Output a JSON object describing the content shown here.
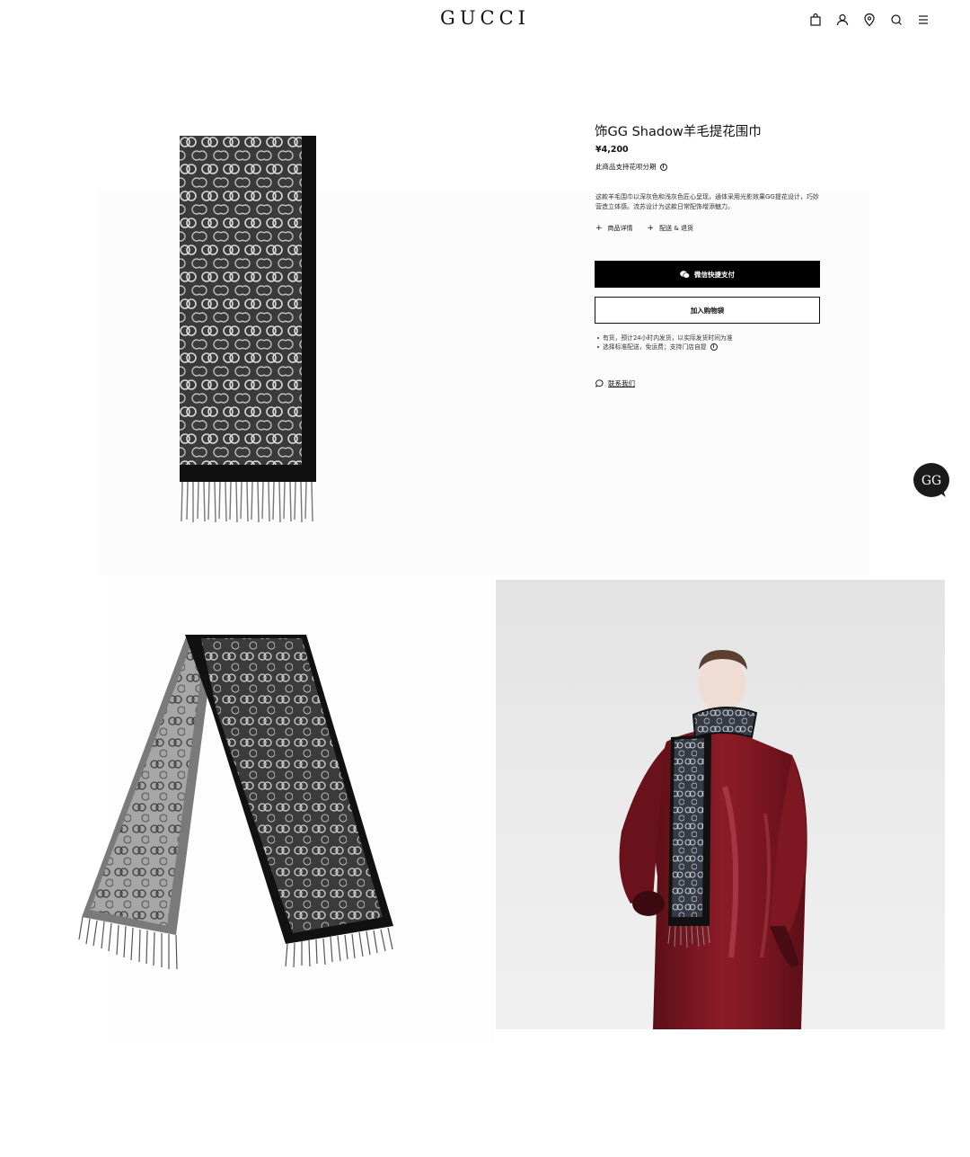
{
  "header": {
    "logo": "GUCCI",
    "icons": [
      "shopping-bag-icon",
      "user-icon",
      "location-pin-icon",
      "search-icon",
      "menu-icon"
    ]
  },
  "product": {
    "title": "饰GG Shadow羊毛提花围巾",
    "price": "¥4,200",
    "installment_note": "此商品支持花呗分期",
    "description": "这款羊毛围巾以深灰色和浅灰色匠心呈现，通体采用光影效果GG提花设计，巧妙营造立体感。流苏设计为这款日常配饰增添魅力。",
    "accordions": [
      {
        "label": "商品详情"
      },
      {
        "label": "配送 & 退货"
      }
    ],
    "buttons": {
      "primary": "微信快捷支付",
      "secondary": "加入购物袋"
    },
    "shipping_notes": [
      "有货，预计24小时内发货，以实际发货时间为准",
      "选择标准配送，免运费；支持门店自提"
    ],
    "contact_label": "联系我们"
  },
  "colors": {
    "primary_button": "#000000",
    "text": "#111111",
    "coat_red": "#7a1620"
  }
}
